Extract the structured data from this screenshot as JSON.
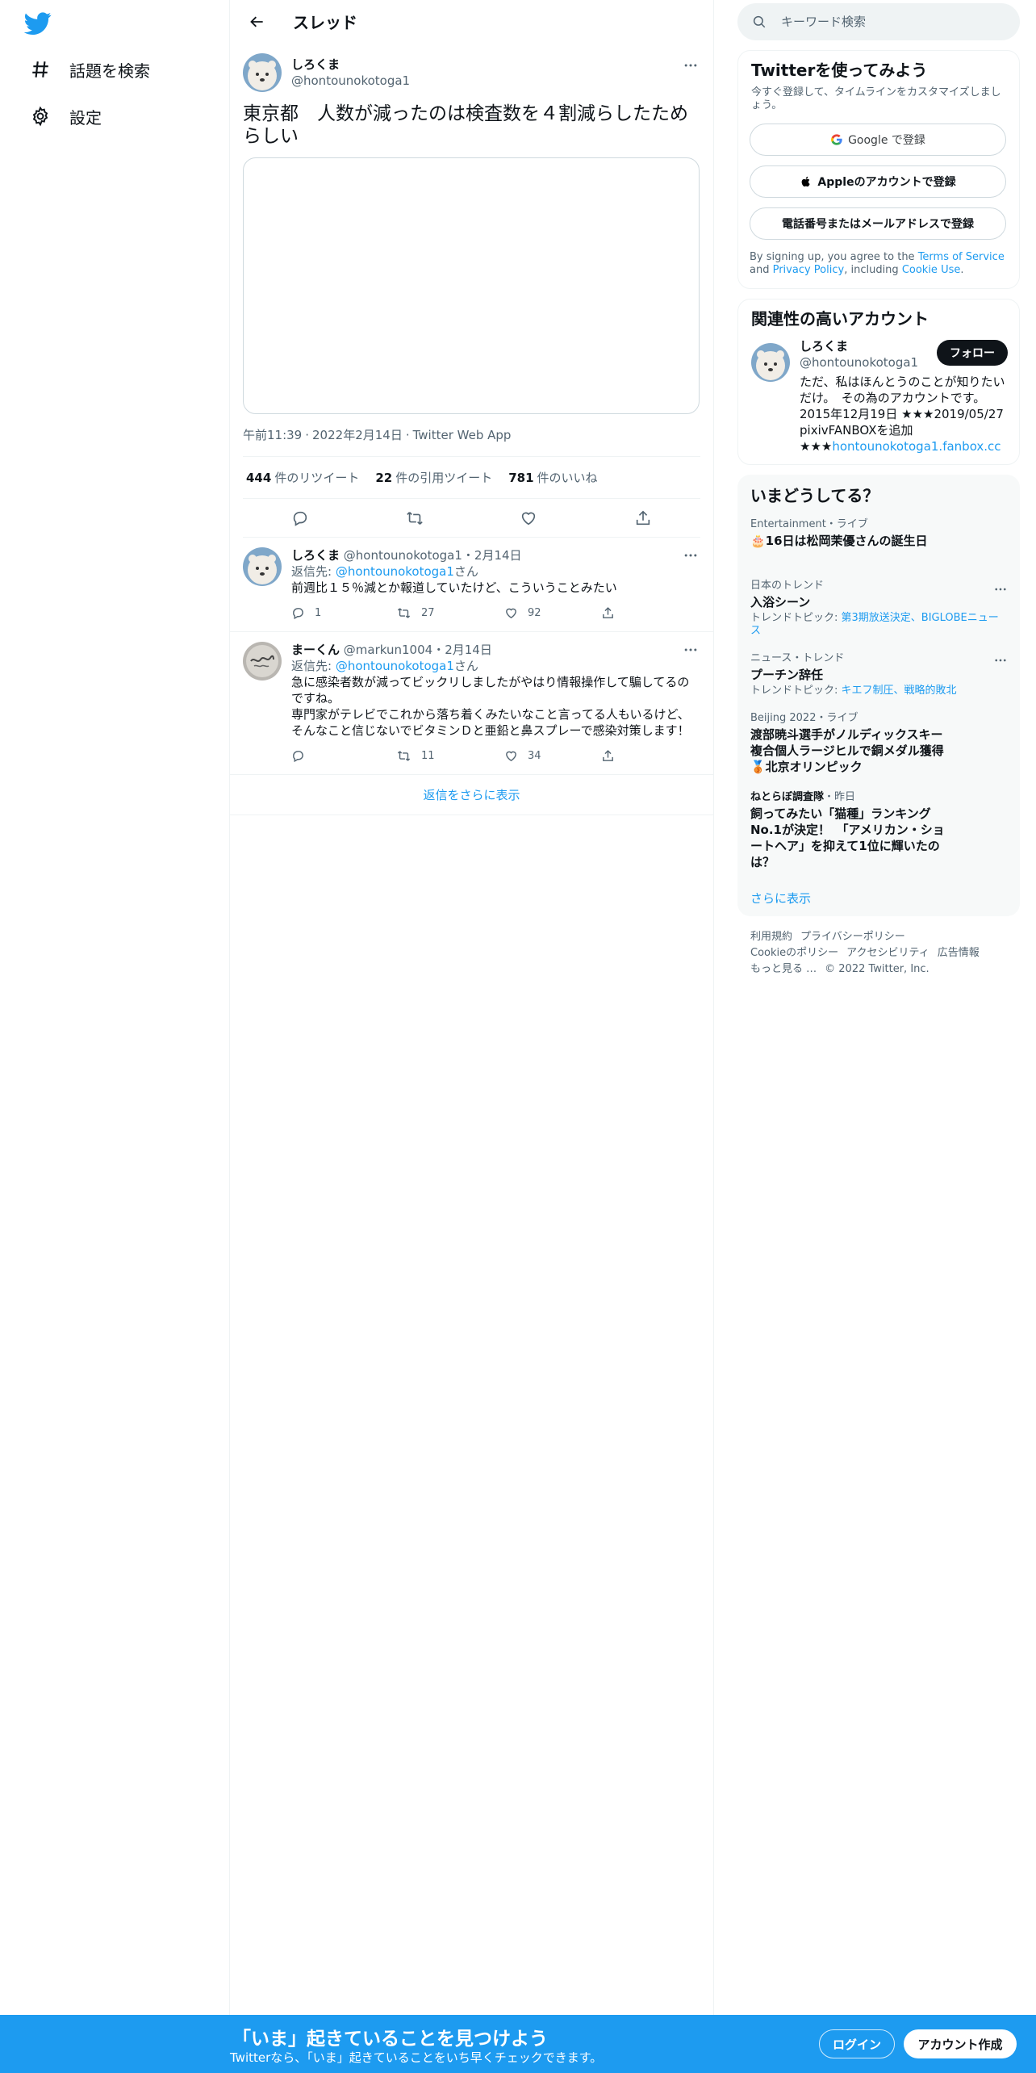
{
  "nav": {
    "logo": "twitter-bird-icon",
    "items": [
      {
        "label": "話題を検索",
        "icon": "hashtag-icon"
      },
      {
        "label": "設定",
        "icon": "gear-icon"
      }
    ]
  },
  "main": {
    "title": "スレッド",
    "focus_tweet": {
      "name": "しろくま",
      "handle": "@hontounokotoga1",
      "text": "東京都　人数が減ったのは検査数を４割減らしたためらしい",
      "time": "午前11:39",
      "date": "2022年2月14日",
      "source": "Twitter Web App",
      "retweets_count": "444",
      "retweets_label": "件のリツイート",
      "quotes_count": "22",
      "quotes_label": "件の引用ツイート",
      "likes_count": "781",
      "likes_label": "件のいいね"
    },
    "replies": [
      {
        "name": "しろくま",
        "handle": "@hontounokotoga1",
        "date": "2月14日",
        "reply_to_prefix": "返信先: ",
        "reply_to_handle": "@hontounokotoga1",
        "reply_to_suffix": "さん",
        "text": "前週比１５％減とか報道していたけど、こういうことみたい",
        "reply_count": "1",
        "retweet_count": "27",
        "like_count": "92"
      },
      {
        "name": "まーくん",
        "handle": "@markun1004",
        "date": "2月14日",
        "reply_to_prefix": "返信先: ",
        "reply_to_handle": "@hontounokotoga1",
        "reply_to_suffix": "さん",
        "text": "急に感染者数が減ってビックリしましたがやはり情報操作して騙してるのですね。\n専門家がテレビでこれから落ち着くみたいなこと言ってる人もいるけど、そんなこと信じないでビタミンＤと亜鉛と鼻スプレーで感染対策します！",
        "reply_count": "",
        "retweet_count": "11",
        "like_count": "34"
      }
    ],
    "show_more_replies": "返信をさらに表示"
  },
  "right": {
    "search_placeholder": "キーワード検索",
    "signup": {
      "title": "Twitterを使ってみよう",
      "subtitle": "今すぐ登録して、タイムラインをカスタマイズしましょう。",
      "google_btn": "Google で登録",
      "apple_btn": "Appleのアカウントで登録",
      "phone_btn": "電話番号またはメールアドレスで登録",
      "terms_1": "By signing up, you agree to the ",
      "terms_tos": "Terms of Service",
      "terms_2": " and ",
      "terms_privacy": "Privacy Policy",
      "terms_3": ", including ",
      "terms_cookie": "Cookie Use",
      "terms_4": "."
    },
    "related": {
      "title": "関連性の高いアカウント",
      "name": "しろくま",
      "handle": "@hontounokotoga1",
      "follow_btn": "フォロー",
      "bio": "ただ、私はほんとうのことが知りたいだけ。　その為のアカウントです。2015年12月19日 ★★★2019/05/27 pixivFANBOXを追加\n★★★",
      "bio_link": "hontounokotoga1.fanbox.cc"
    },
    "trends": {
      "title": "いまどうしてる？",
      "items": [
        {
          "meta": "Entertainment・ライブ",
          "title": "🎂16日は松岡茉優さんの誕生日",
          "topic_prefix": "",
          "topic": ""
        },
        {
          "meta": "日本のトレンド",
          "title": "入浴シーン",
          "topic_prefix": "トレンドトピック: ",
          "topic": "第3期放送決定、BIGLOBEニュース"
        },
        {
          "meta": "ニュース・トレンド",
          "title": "プーチン辞任",
          "topic_prefix": "トレンドトピック: ",
          "topic": "キエフ制圧、戦略的敗北"
        },
        {
          "meta": "Beijing 2022・ライブ",
          "title": "渡部暁斗選手がノルディックスキー複合個人ラージヒルで銅メダル獲得🥉北京オリンピック",
          "topic_prefix": "",
          "topic": ""
        },
        {
          "meta_bold": "ねとらぼ調査隊",
          "meta": "・昨日",
          "title": "飼ってみたい「猫種」ランキングNo.1が決定！　「アメリカン・ショートヘア」を抑えて1位に輝いたのは？",
          "topic_prefix": "",
          "topic": ""
        }
      ],
      "show_more": "さらに表示"
    },
    "footer": {
      "links": [
        "利用規約",
        "プライバシーポリシー",
        "Cookieのポリシー",
        "アクセシビリティ",
        "広告情報",
        "もっと見る …"
      ],
      "copyright": "© 2022 Twitter, Inc."
    }
  },
  "bottom_bar": {
    "title": "「いま」起きていることを見つけよう",
    "subtitle": "Twitterなら、「いま」起きていることをいち早くチェックできます。",
    "login": "ログイン",
    "signup": "アカウント作成"
  },
  "colors": {
    "accent": "#1d9bf0",
    "text": "#0f1419",
    "secondary": "#536471",
    "border": "#eff3f4"
  }
}
